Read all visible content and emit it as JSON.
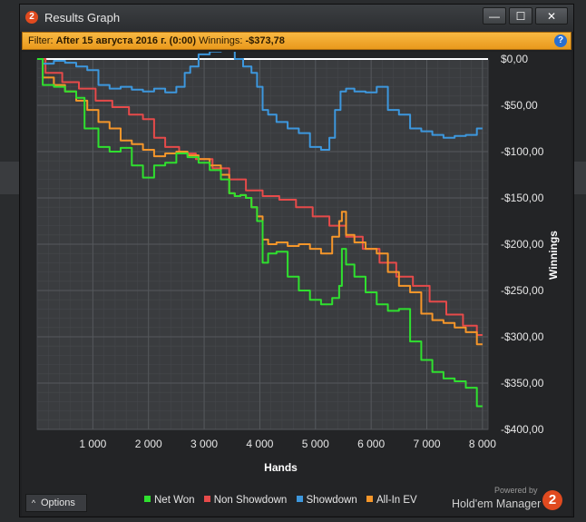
{
  "window": {
    "title": "Results Graph",
    "app_badge": "2",
    "controls": [
      "—",
      "☐",
      "✕"
    ]
  },
  "filter": {
    "prefix": "Filter:",
    "value": "After 15 августа 2016 г. (0:00)",
    "winnings_label": "Winnings:",
    "winnings_value": "-$373,78",
    "help_icon": "?"
  },
  "options_button": {
    "chevron": "^",
    "label": "Options"
  },
  "branding": {
    "powered": "Powered by",
    "name": "Hold'em Manager",
    "logo": "2"
  },
  "colors": {
    "net_won": "#2fe02f",
    "non_showdown": "#e64a4a",
    "showdown": "#3d97dd",
    "all_in_ev": "#f5962a",
    "zero_line": "#ffffff",
    "filter_bar": "#f3a92e",
    "brand": "#e04a1f"
  },
  "chart_data": {
    "type": "line",
    "title": "",
    "xlabel": "Hands",
    "ylabel": "Winnings",
    "xlim": [
      0,
      8100
    ],
    "ylim": [
      -400,
      0
    ],
    "x_ticks": [
      1000,
      2000,
      3000,
      4000,
      5000,
      6000,
      7000,
      8000
    ],
    "x_tick_labels": [
      "1 000",
      "2 000",
      "3 000",
      "4 000",
      "5 000",
      "6 000",
      "7 000",
      "8 000"
    ],
    "y_ticks": [
      0,
      -50,
      -100,
      -150,
      -200,
      -250,
      -300,
      -350,
      -400
    ],
    "y_tick_labels": [
      "$0,00",
      "-$50,00",
      "-$100,00",
      "-$150,00",
      "-$200,00",
      "-$250,00",
      "-$300,00",
      "-$350,00",
      "-$400,00"
    ],
    "grid": true,
    "legend_position": "bottom",
    "series": [
      {
        "name": "Net Won",
        "color": "#2fe02f",
        "x": [
          0,
          200,
          400,
          600,
          800,
          900,
          1000,
          1200,
          1400,
          1600,
          1800,
          2000,
          2200,
          2400,
          2600,
          2800,
          3000,
          3200,
          3400,
          3500,
          3600,
          3700,
          3800,
          3900,
          4000,
          4100,
          4200,
          4400,
          4600,
          4800,
          5000,
          5200,
          5400,
          5450,
          5500,
          5600,
          5800,
          6000,
          6200,
          6400,
          6600,
          6800,
          7000,
          7200,
          7400,
          7600,
          7800,
          8000
        ],
        "y": [
          0,
          -28,
          -30,
          -35,
          -42,
          -75,
          -75,
          -95,
          -100,
          -96,
          -115,
          -128,
          -115,
          -112,
          -102,
          -106,
          -112,
          -120,
          -130,
          -145,
          -148,
          -147,
          -150,
          -160,
          -175,
          -220,
          -210,
          -208,
          -235,
          -250,
          -260,
          -265,
          -258,
          -245,
          -205,
          -222,
          -235,
          -252,
          -265,
          -272,
          -270,
          -305,
          -325,
          -338,
          -345,
          -348,
          -355,
          -375
        ]
      },
      {
        "name": "Non Showdown",
        "color": "#e64a4a",
        "x": [
          0,
          300,
          600,
          900,
          1200,
          1500,
          1800,
          2000,
          2200,
          2400,
          2700,
          3000,
          3300,
          3600,
          3900,
          4200,
          4500,
          4800,
          5100,
          5400,
          5700,
          6000,
          6300,
          6600,
          6900,
          7200,
          7500,
          7800,
          8000
        ],
        "y": [
          0,
          -15,
          -25,
          -32,
          -45,
          -52,
          -60,
          -65,
          -85,
          -95,
          -102,
          -108,
          -118,
          -130,
          -142,
          -148,
          -152,
          -160,
          -170,
          -180,
          -192,
          -205,
          -220,
          -235,
          -245,
          -262,
          -276,
          -288,
          -298
        ]
      },
      {
        "name": "Showdown",
        "color": "#3d97dd",
        "x": [
          0,
          200,
          400,
          600,
          800,
          1000,
          1200,
          1400,
          1600,
          1800,
          2000,
          2200,
          2400,
          2600,
          2700,
          2800,
          3000,
          3200,
          3400,
          3500,
          3600,
          3800,
          3900,
          4000,
          4100,
          4200,
          4400,
          4600,
          4800,
          5000,
          5200,
          5300,
          5400,
          5500,
          5600,
          5800,
          6000,
          6200,
          6400,
          6600,
          6800,
          7000,
          7200,
          7400,
          7600,
          7800,
          8000
        ],
        "y": [
          0,
          -5,
          -2,
          -4,
          -8,
          -12,
          -28,
          -32,
          -30,
          -33,
          -35,
          -32,
          -36,
          -30,
          -15,
          -8,
          5,
          8,
          12,
          14,
          0,
          -8,
          -15,
          -30,
          -55,
          -60,
          -68,
          -75,
          -80,
          -95,
          -98,
          -85,
          -55,
          -35,
          -32,
          -35,
          -36,
          -30,
          -55,
          -60,
          -75,
          -78,
          -82,
          -85,
          -83,
          -82,
          -75
        ]
      },
      {
        "name": "All-In EV",
        "color": "#f5962a",
        "x": [
          0,
          200,
          400,
          600,
          800,
          1000,
          1200,
          1400,
          1600,
          1800,
          2000,
          2200,
          2400,
          2600,
          2800,
          3000,
          3200,
          3400,
          3500,
          3600,
          3700,
          3800,
          3900,
          4000,
          4100,
          4200,
          4400,
          4600,
          4800,
          5000,
          5200,
          5400,
          5450,
          5500,
          5600,
          5800,
          6000,
          6200,
          6400,
          6600,
          6800,
          7000,
          7200,
          7400,
          7600,
          7800,
          8000
        ],
        "y": [
          0,
          -20,
          -28,
          -35,
          -45,
          -55,
          -68,
          -75,
          -88,
          -92,
          -98,
          -105,
          -102,
          -100,
          -104,
          -108,
          -115,
          -125,
          -145,
          -148,
          -147,
          -150,
          -160,
          -170,
          -195,
          -200,
          -198,
          -202,
          -200,
          -205,
          -210,
          -192,
          -175,
          -165,
          -190,
          -198,
          -205,
          -210,
          -230,
          -245,
          -252,
          -275,
          -282,
          -285,
          -290,
          -295,
          -308
        ]
      }
    ]
  }
}
